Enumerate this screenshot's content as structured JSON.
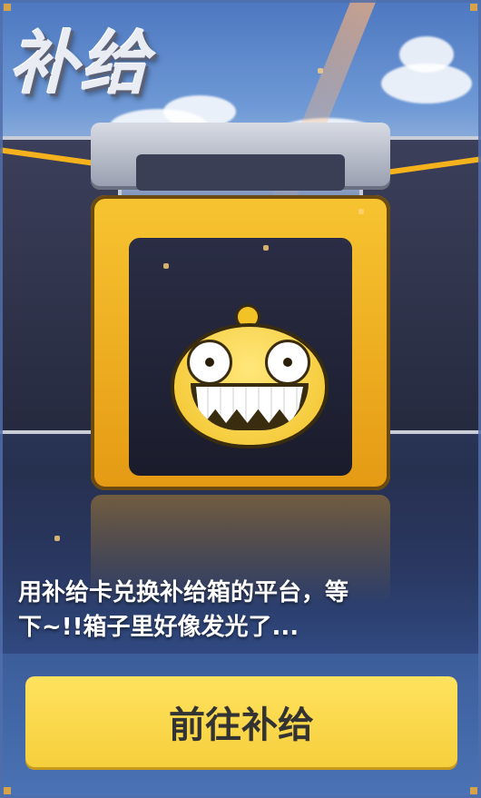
{
  "title": "补给",
  "caption": {
    "line1": "用补给卡兑换补给箱的平台，等",
    "line2": "下~!!箱子里好像发光了..."
  },
  "cta": {
    "label": "前往补给"
  },
  "colors": {
    "button": "#f6cf3c",
    "button_text": "#333333",
    "caption_text": "#ffffff",
    "box_accent": "#f2c227"
  }
}
